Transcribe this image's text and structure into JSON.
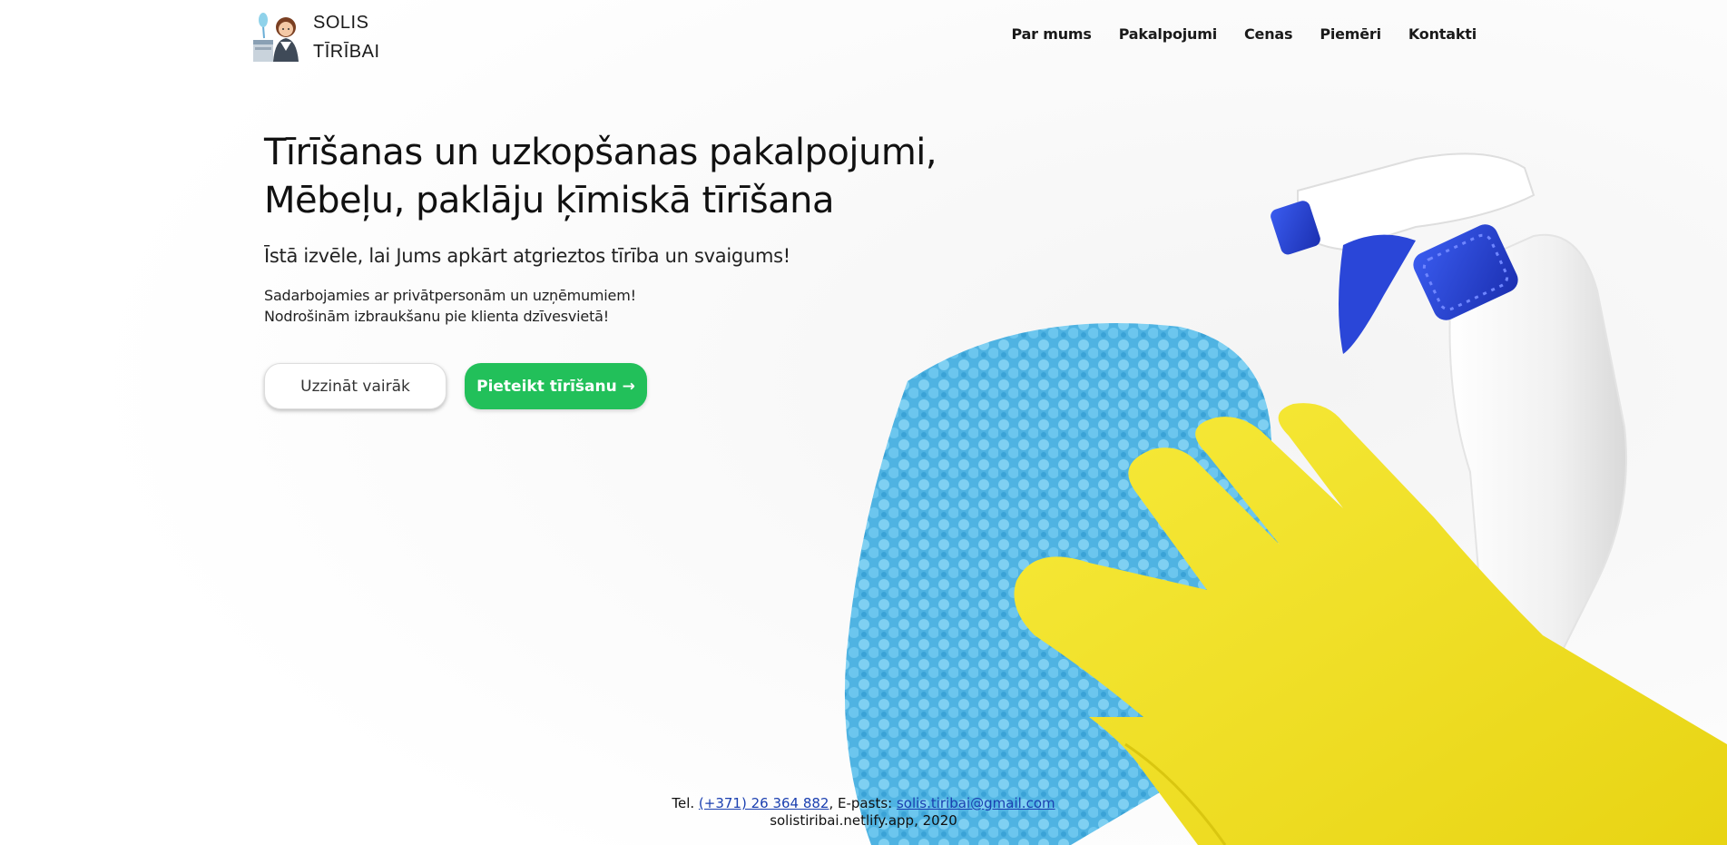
{
  "brand": {
    "line1": "SOLIS",
    "line2": "TĪRĪBAI",
    "icon": "cleaning-lady-icon"
  },
  "nav": {
    "items": [
      {
        "label": "Par mums"
      },
      {
        "label": "Pakalpojumi"
      },
      {
        "label": "Cenas"
      },
      {
        "label": "Piemēri"
      },
      {
        "label": "Kontakti"
      }
    ]
  },
  "hero": {
    "title_line1": "Tīrīšanas un uzkopšanas pakalpojumi,",
    "title_line2": "Mēbeļu, paklāju ķīmiskā tīrīšana",
    "lead": "Īstā izvēle, lai Jums apkārt atgrieztos tīrība un svaigums!",
    "desc_line1": "Sadarbojamies ar privātpersonām un uzņēmumiem!",
    "desc_line2": "Nodrošinām izbraukšanu pie klienta dzīvesvietā!",
    "btn_more": "Uzzināt vairāk",
    "btn_order": "Pieteikt tīrīšanu →"
  },
  "footer": {
    "tel_label": "Tel. ",
    "tel": "(+371) 26 364 882",
    "email_label": ", E-pasts: ",
    "email": "solis.tiribai@gmail.com",
    "site": "solistiribai.netlify.app, 2020"
  },
  "colors": {
    "accent": "#22c05a",
    "glove": "#f2e22c",
    "cloth": "#55b8e4",
    "spray_cap": "#2440d0"
  }
}
